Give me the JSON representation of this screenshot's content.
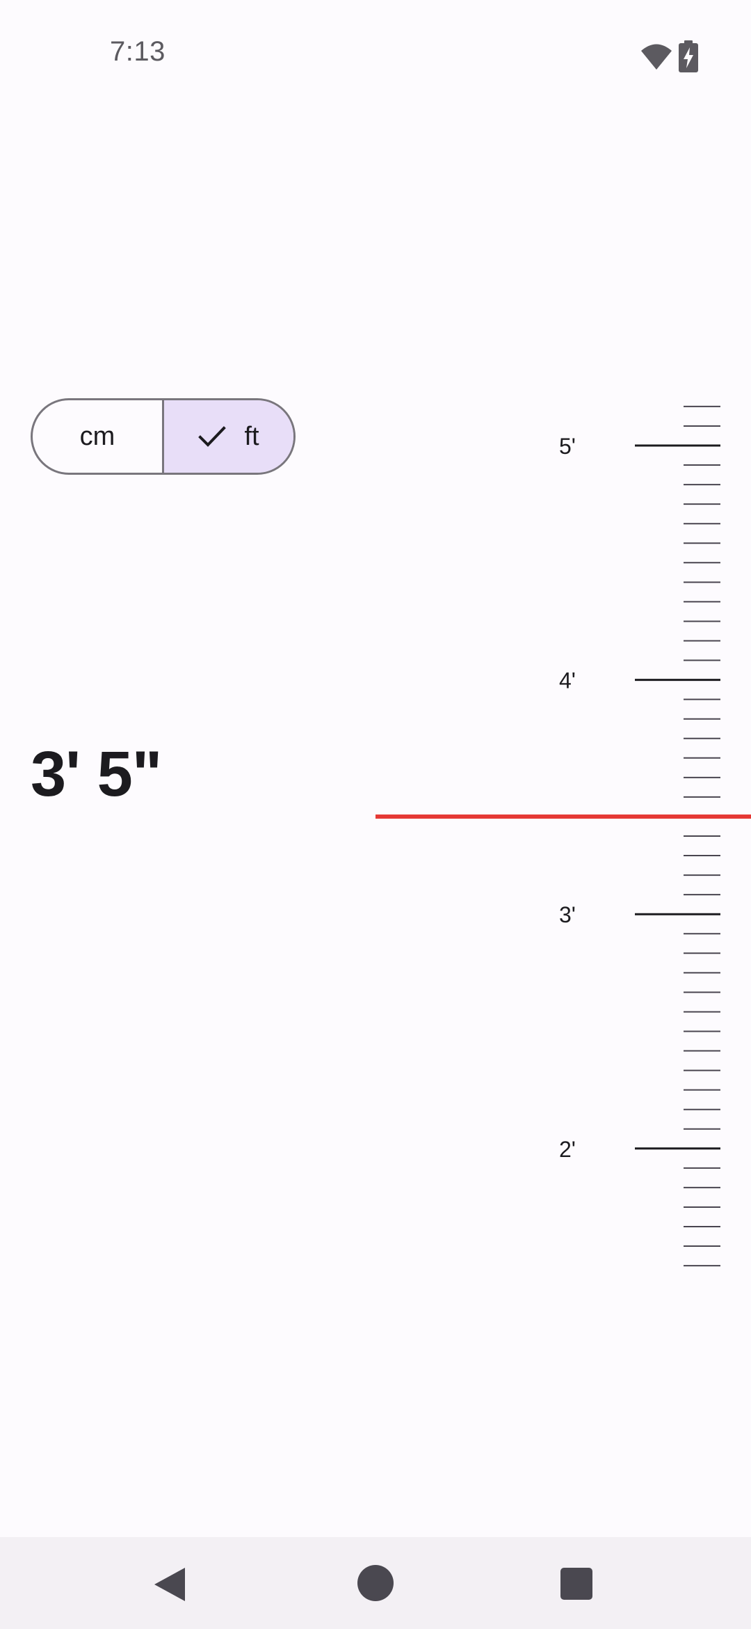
{
  "status_bar": {
    "time": "7:13",
    "icons": [
      "wifi-icon",
      "battery-charging-icon"
    ]
  },
  "unit_toggle": {
    "options": [
      {
        "label": "cm",
        "selected": false
      },
      {
        "label": "ft",
        "selected": true,
        "icon": "check-icon"
      }
    ]
  },
  "readout": {
    "value": "3' 5\""
  },
  "ruler": {
    "unit": "ft",
    "major_labels": [
      "5'",
      "4'",
      "3'",
      "2'"
    ],
    "current_value_inches": 41,
    "indicator_color": "#e53935"
  },
  "nav_bar": {
    "icons": [
      "back-icon",
      "home-icon",
      "recents-icon"
    ]
  },
  "colors": {
    "background": "#fdfbfe",
    "selected_segment": "#e8def8",
    "outline": "#79767d",
    "text_primary": "#1c1b1f"
  }
}
